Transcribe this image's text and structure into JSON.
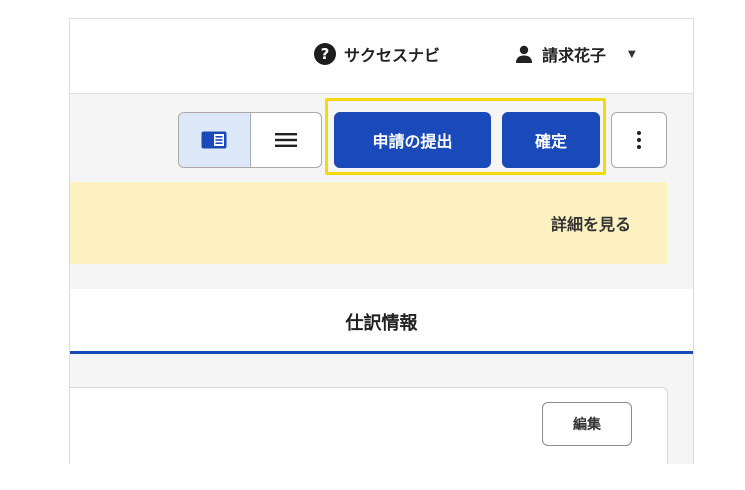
{
  "header": {
    "help_label": "サクセスナビ",
    "help_icon": "question-circle-icon",
    "user_name": "請求花子",
    "user_icon": "person-icon",
    "caret_icon": "caret-down-icon"
  },
  "toolbar": {
    "view_toggle": [
      {
        "icon": "sidebar-panel-icon",
        "active": true
      },
      {
        "icon": "list-menu-icon",
        "active": false
      }
    ],
    "submit_label": "申請の提出",
    "confirm_label": "確定",
    "more_icon": "vertical-ellipsis-icon"
  },
  "notice": {
    "link_label": "詳細を見る"
  },
  "tabs": {
    "active_label": "仕訳情報"
  },
  "panel": {
    "edit_label": "編集"
  },
  "colors": {
    "primary": "#1a49b9",
    "highlight": "#f5d90f",
    "notice_bg": "#fdf0c1",
    "toggle_active_bg": "#dde8f8"
  }
}
